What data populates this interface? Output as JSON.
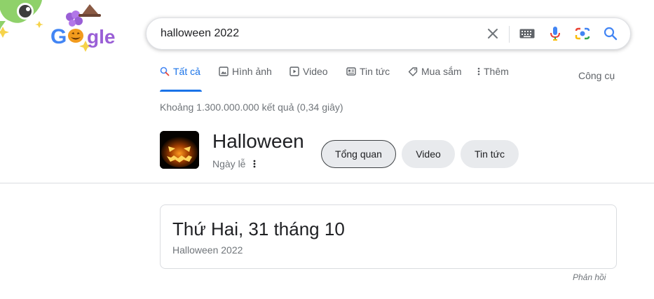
{
  "logo": {
    "alt": "Google"
  },
  "search": {
    "query": "halloween 2022"
  },
  "tabs": [
    {
      "label": "Tất cả",
      "icon": "search-icon",
      "active": true
    },
    {
      "label": "Hình ảnh",
      "icon": "image-icon",
      "active": false
    },
    {
      "label": "Video",
      "icon": "video-icon",
      "active": false
    },
    {
      "label": "Tin tức",
      "icon": "news-icon",
      "active": false
    },
    {
      "label": "Mua sắm",
      "icon": "tag-icon",
      "active": false
    },
    {
      "label": "Thêm",
      "icon": "more-vert-icon",
      "active": false
    }
  ],
  "tools_label": "Công cụ",
  "result_stats": "Khoảng 1.300.000.000 kết quả (0,34 giây)",
  "entity": {
    "title": "Halloween",
    "subtitle": "Ngày lễ",
    "chips": [
      {
        "label": "Tổng quan",
        "selected": true
      },
      {
        "label": "Video",
        "selected": false
      },
      {
        "label": "Tin tức",
        "selected": false
      }
    ]
  },
  "card": {
    "date": "Thứ Hai, 31 tháng 10",
    "subtitle": "Halloween 2022"
  },
  "feedback_label": "Phản hồi",
  "colors": {
    "accent": "#1a73e8",
    "text": "#202124",
    "muted": "#70757a",
    "chip_bg": "#e8eaed"
  }
}
